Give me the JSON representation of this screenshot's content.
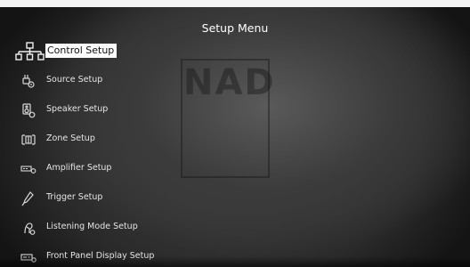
{
  "header": {
    "title": "Setup Menu"
  },
  "watermark": {
    "text": "NAD"
  },
  "menu": {
    "items": [
      {
        "label": "Control Setup",
        "icon": "control-setup-icon",
        "selected": true
      },
      {
        "label": "Source Setup",
        "icon": "source-setup-icon"
      },
      {
        "label": "Speaker Setup",
        "icon": "speaker-setup-icon"
      },
      {
        "label": "Zone Setup",
        "icon": "zone-setup-icon"
      },
      {
        "label": "Amplifier Setup",
        "icon": "amplifier-setup-icon"
      },
      {
        "label": "Trigger Setup",
        "icon": "trigger-setup-icon"
      },
      {
        "label": "Listening Mode Setup",
        "icon": "listening-mode-icon"
      },
      {
        "label": "Front Panel Display Setup",
        "icon": "front-panel-display-icon"
      }
    ]
  },
  "colors": {
    "selection_bg": "#ffffff",
    "text": "#e6e6e6",
    "title": "#ffffff"
  }
}
